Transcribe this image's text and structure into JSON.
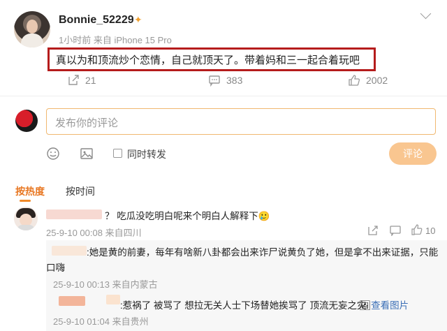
{
  "post": {
    "username": "Bonnie_52229",
    "meta": "1小时前 来自 iPhone 15 Pro",
    "text": "真以为和顶流炒个恋情，自己就顶天了。带着妈和三一起合着玩吧",
    "actions": {
      "share_count": "21",
      "comment_count": "383",
      "like_count": "2002"
    }
  },
  "composer": {
    "placeholder": "发布你的评论",
    "forward_label": "同时转发",
    "submit_label": "评论"
  },
  "sort": {
    "hot_label": "按热度",
    "time_label": "按时间"
  },
  "comments": [
    {
      "text_tail": "？ 吃瓜没吃明白呢来个明白人解释下🥲",
      "meta": "25-9-10 00:08 来自四川",
      "like_count": "10",
      "replies": [
        {
          "line1": ":她是黄的前妻，每年有啥新八卦都会出来诈尸说黄负了她，但是拿不出来证据，只能",
          "line2": "口嗨",
          "meta": "25-9-10 00:13 来自内蒙古"
        },
        {
          "text": ":惹祸了 被骂了 想拉无关人士下场替她挨骂了 顶流无妄之灾",
          "link": "查看图片",
          "meta": "25-9-10 01:04 来自贵州"
        }
      ]
    }
  ],
  "colors": {
    "highlight": "#b51c1c",
    "accent": "#e87722",
    "submit_bg": "#f9c690"
  }
}
